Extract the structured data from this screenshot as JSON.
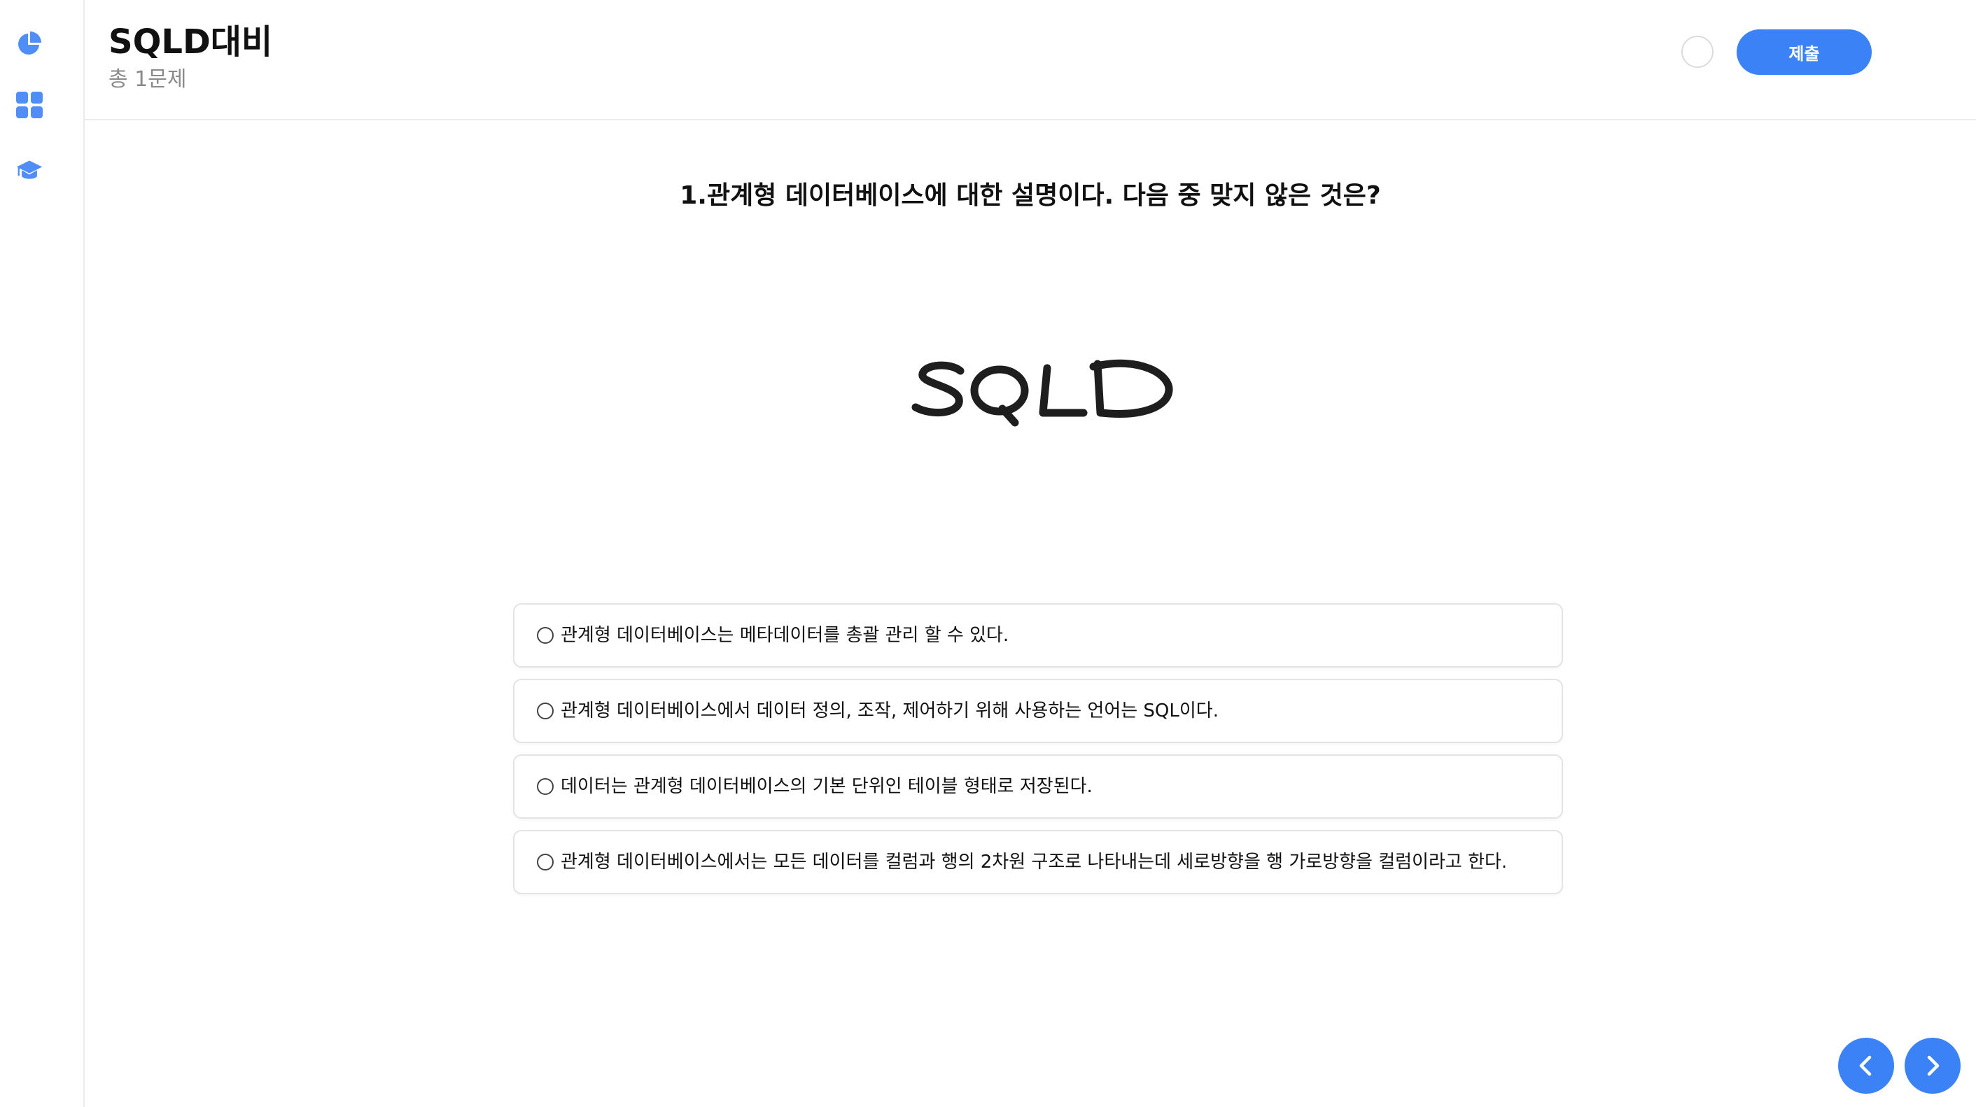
{
  "sidebar": {
    "items": [
      {
        "icon": "pie-chart-icon"
      },
      {
        "icon": "grid-icon"
      },
      {
        "icon": "graduation-cap-icon"
      }
    ]
  },
  "header": {
    "title": "SQLD대비",
    "subtitle": "총 1문제",
    "submit_label": "제출"
  },
  "question": {
    "text": "1.관계형 데이터베이스에 대한 설명이다. 다음 중 맞지 않은 것은?",
    "image_text": "SQLD",
    "options": [
      "관계형 데이터베이스는 메타데이터를 총괄 관리 할 수 있다.",
      "관계형 데이터베이스에서 데이터 정의, 조작, 제어하기 위해 사용하는 언어는 SQL이다.",
      "데이터는 관계형 데이터베이스의 기본 단위인 테이블 형태로 저장된다.",
      "관계형 데이터베이스에서는 모든 데이터를 컬럼과 행의 2차원 구조로 나타내는데 세로방향을 행 가로방향을 컬럼이라고 한다."
    ]
  },
  "colors": {
    "accent": "#3b82f6",
    "icon": "#4f8ef7"
  }
}
